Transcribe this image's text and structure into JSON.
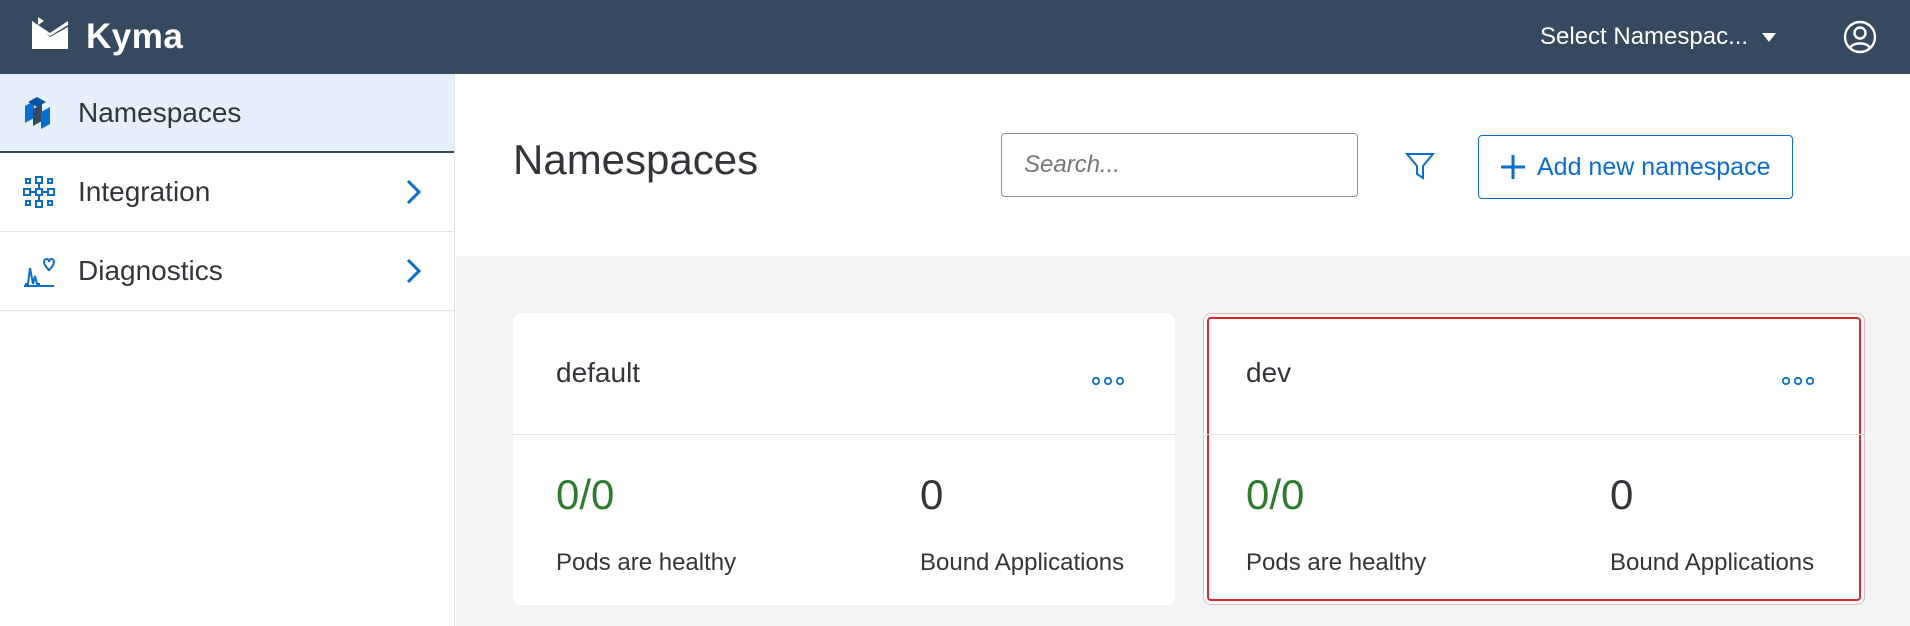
{
  "shell": {
    "brand": "Kyma",
    "namespace_selector": "Select Namespac...",
    "icons": {
      "logo": "kyma-logo",
      "caret": "caret-down-icon",
      "user": "user-avatar-icon"
    },
    "colors": {
      "bar": "#354a5f"
    }
  },
  "sidebar": {
    "items": [
      {
        "label": "Namespaces",
        "icon": "namespaces-icon",
        "active": true,
        "expandable": false
      },
      {
        "label": "Integration",
        "icon": "integration-icon",
        "active": false,
        "expandable": true
      },
      {
        "label": "Diagnostics",
        "icon": "diagnostics-icon",
        "active": false,
        "expandable": true
      }
    ]
  },
  "main": {
    "title": "Namespaces",
    "search_placeholder": "Search...",
    "add_button_label": "Add new namespace",
    "accent_color": "#0a6ed1",
    "cards": [
      {
        "name": "default",
        "pods_value": "0/0",
        "pods_label": "Pods are healthy",
        "apps_value": "0",
        "apps_label": "Bound Applications",
        "selected": false
      },
      {
        "name": "dev",
        "pods_value": "0/0",
        "pods_label": "Pods are healthy",
        "apps_value": "0",
        "apps_label": "Bound Applications",
        "selected": true
      }
    ]
  }
}
